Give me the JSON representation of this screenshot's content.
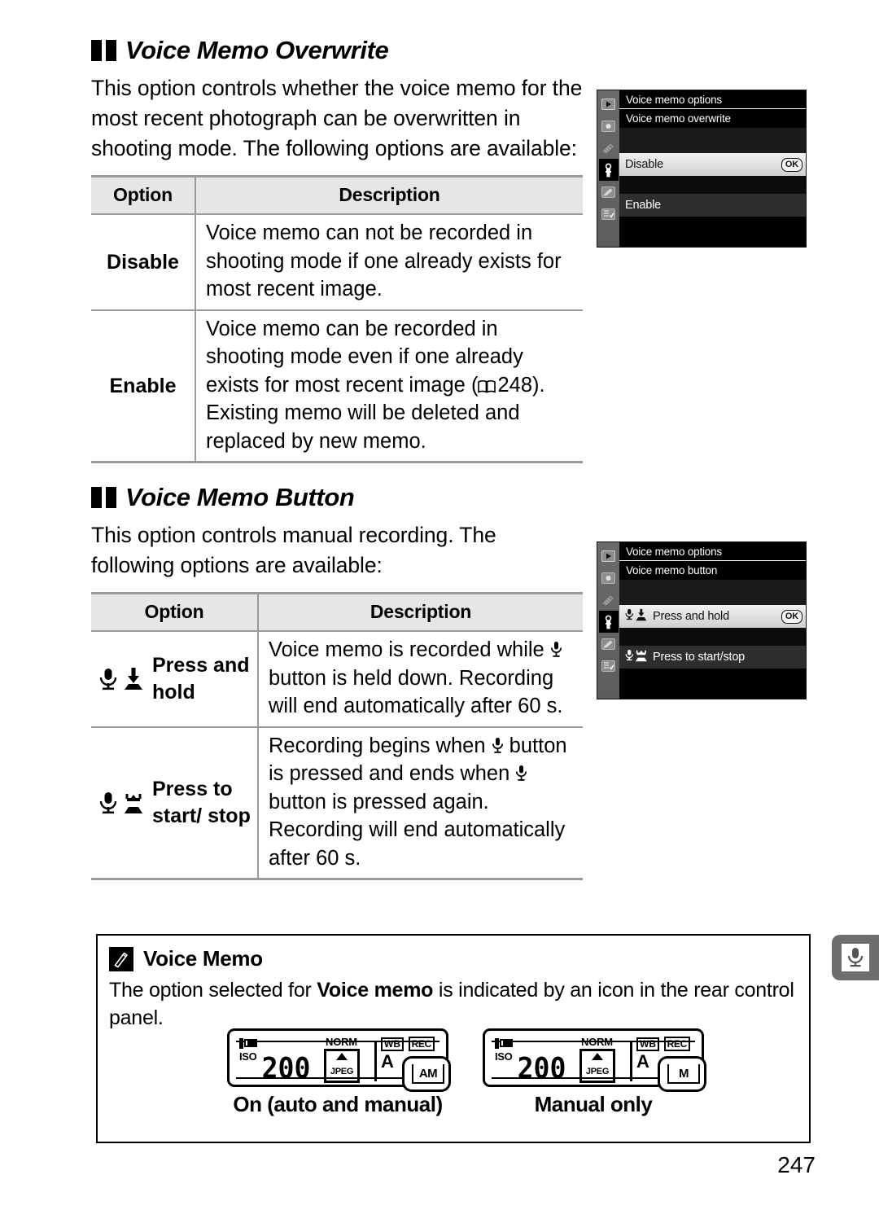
{
  "page": {
    "number": "247",
    "side_tab_icon": "microphone-icon"
  },
  "section1": {
    "heading": "Voice Memo Overwrite",
    "paragraph": "This option controls whether the voice memo for the most recent photograph can be overwritten in shooting mode.  The following options are available:",
    "table": {
      "headers": [
        "Option",
        "Description"
      ],
      "rows": [
        {
          "option": "Disable",
          "description": "Voice memo can not be recorded in shooting mode if one already exists for most recent image."
        },
        {
          "option": "Enable",
          "description_part1": "Voice memo can be recorded in shooting mode even if one already exists for most recent image (",
          "page_ref": "248",
          "description_part2": "). Existing memo will be deleted and replaced by new memo."
        }
      ]
    },
    "menu": {
      "title": "Voice memo options",
      "subtitle": "Voice memo overwrite",
      "ok_badge": "OK",
      "items": [
        {
          "label": "Disable",
          "selected": true
        },
        {
          "label": "Enable",
          "selected": false
        }
      ],
      "rail_icons": [
        "playback-icon",
        "shooting-menu-icon",
        "custom-settings-icon",
        "setup-menu-icon",
        "retouch-menu-icon",
        "recent-settings-icon"
      ]
    }
  },
  "section2": {
    "heading": "Voice Memo Button",
    "paragraph": "This option controls manual recording.  The following options are available:",
    "table": {
      "headers": [
        "Option",
        "Description"
      ],
      "rows": [
        {
          "icon": "mic-press-and-hold-icon",
          "option": "Press and hold",
          "description_part1": "Voice memo is recorded while ",
          "description_part2": " button is held down.  Recording will end automatically after 60 s."
        },
        {
          "icon": "mic-press-start-stop-icon",
          "option": "Press to start/ stop",
          "description_part1": "Recording begins when ",
          "description_part2": " button is pressed and ends when ",
          "description_part3": " button is pressed again. Recording will end automatically after 60 s."
        }
      ]
    },
    "menu": {
      "title": "Voice memo options",
      "subtitle": "Voice memo button",
      "ok_badge": "OK",
      "items": [
        {
          "label": "Press and hold",
          "selected": true
        },
        {
          "label": "Press to start/stop",
          "selected": false
        }
      ]
    }
  },
  "note": {
    "icon": "pencil-note-icon",
    "title": "Voice Memo",
    "text_part1": "The option selected for ",
    "text_bold": "Voice memo",
    "text_part2": " is indicated by an icon in the rear control panel.",
    "panels": [
      {
        "caption": "On (auto and manual)",
        "iso_label": "ISO",
        "iso_value": "200",
        "quality": "NORM",
        "format": "JPEG",
        "wb_label": "WB",
        "wb_value": "A",
        "rec_label": "REC",
        "mode": "AM"
      },
      {
        "caption": "Manual only",
        "iso_label": "ISO",
        "iso_value": "200",
        "quality": "NORM",
        "format": "JPEG",
        "wb_label": "WB",
        "wb_value": "A",
        "rec_label": "REC",
        "mode": "M"
      }
    ]
  }
}
